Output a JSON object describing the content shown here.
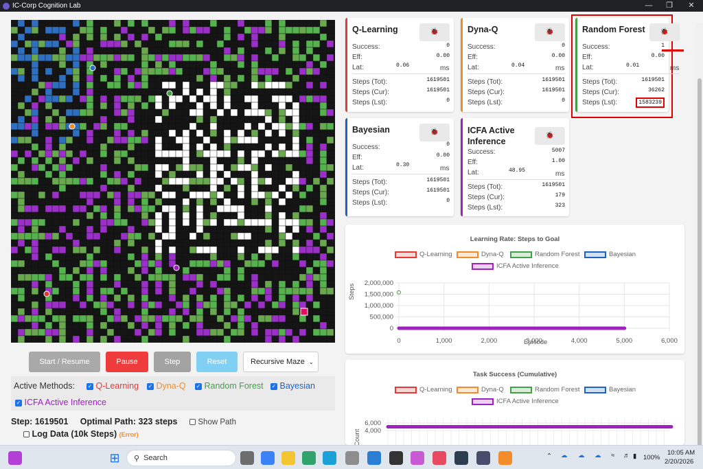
{
  "window": {
    "title": "IC-Corp Cognition Lab"
  },
  "controls": {
    "start": "Start / Resume",
    "pause": "Pause",
    "step": "Step",
    "reset": "Reset",
    "maze_type": "Recursive Maze"
  },
  "methods": {
    "label": "Active Methods:",
    "items": [
      {
        "name": "Q-Learning",
        "color": "#e53935"
      },
      {
        "name": "Dyna-Q",
        "color": "#f28c28"
      },
      {
        "name": "Random Forest",
        "color": "#43a047"
      },
      {
        "name": "Bayesian",
        "color": "#1e63c4"
      },
      {
        "name": "ICFA Active Inference",
        "color": "#a020c0"
      }
    ]
  },
  "status": {
    "step_label": "Step:",
    "step_value": "1619501",
    "optimal_label": "Optimal Path:",
    "optimal_value": "323 steps",
    "show_path": "Show Path",
    "log_data": "Log Data (10k Steps)",
    "log_error": "(Error)"
  },
  "row_labels": {
    "success": "Success:",
    "eff": "Eff:",
    "lat": "Lat:",
    "ms": "ms",
    "steps_tot": "Steps (Tot):",
    "steps_cur": "Steps (Cur):",
    "steps_lst": "Steps (Lst):"
  },
  "cards": {
    "qlearning": {
      "title": "Q-Learning",
      "success": "0",
      "eff": "0.00",
      "lat": "0.06",
      "tot": "1619501",
      "cur": "1619501",
      "lst": "0",
      "color": "#e53935"
    },
    "dynaq": {
      "title": "Dyna-Q",
      "success": "0",
      "eff": "0.00",
      "lat": "0.04",
      "tot": "1619501",
      "cur": "1619501",
      "lst": "0",
      "color": "#f28c28"
    },
    "rf": {
      "title": "Random Forest",
      "success": "1",
      "eff": "0.00",
      "lat": "0.01",
      "tot": "1619501",
      "cur": "36262",
      "lst": "1583239",
      "color": "#43a047"
    },
    "bayes": {
      "title": "Bayesian",
      "success": "0",
      "eff": "0.00",
      "lat": "0.30",
      "tot": "1619501",
      "cur": "1619501",
      "lst": "0",
      "color": "#1e63c4"
    },
    "icfa": {
      "title_1": "ICFA Active",
      "title_2": "Inference",
      "success": "5007",
      "eff": "1.00",
      "lat": "48.95",
      "tot": "1619501",
      "cur": "179",
      "lst": "323",
      "color": "#a020c0"
    }
  },
  "chart_data": [
    {
      "type": "line",
      "title": "Learning Rate: Steps to Goal",
      "xlabel": "Episode",
      "ylabel": "Steps",
      "x_ticks": [
        "0",
        "1,000",
        "2,000",
        "3,000",
        "4,000",
        "5,000",
        "6,000"
      ],
      "y_ticks": [
        "0",
        "500,000",
        "1,000,000",
        "1,500,000",
        "2,000,000"
      ],
      "xlim": [
        0,
        6000
      ],
      "ylim": [
        0,
        2000000
      ],
      "series": [
        {
          "name": "Q-Learning",
          "points": []
        },
        {
          "name": "Dyna-Q",
          "points": []
        },
        {
          "name": "Random Forest",
          "points": [
            [
              0,
              1583239
            ]
          ]
        },
        {
          "name": "Bayesian",
          "points": []
        },
        {
          "name": "ICFA Active Inference",
          "points": [
            [
              0,
              323
            ],
            [
              5007,
              323
            ]
          ]
        }
      ]
    },
    {
      "type": "line",
      "title": "Task Success (Cumulative)",
      "ylabel": "Count",
      "y_ticks": [
        "4,000",
        "6,000"
      ],
      "series": [
        {
          "name": "Q-Learning",
          "values": [
            0
          ]
        },
        {
          "name": "Dyna-Q",
          "values": [
            0
          ]
        },
        {
          "name": "Random Forest",
          "values": [
            1
          ]
        },
        {
          "name": "Bayesian",
          "values": [
            0
          ]
        },
        {
          "name": "ICFA Active Inference",
          "values": [
            5007
          ]
        }
      ]
    }
  ],
  "taskbar": {
    "search": "Search",
    "battery": "100%",
    "time": "10:05 AM",
    "date": "2/20/2026"
  }
}
